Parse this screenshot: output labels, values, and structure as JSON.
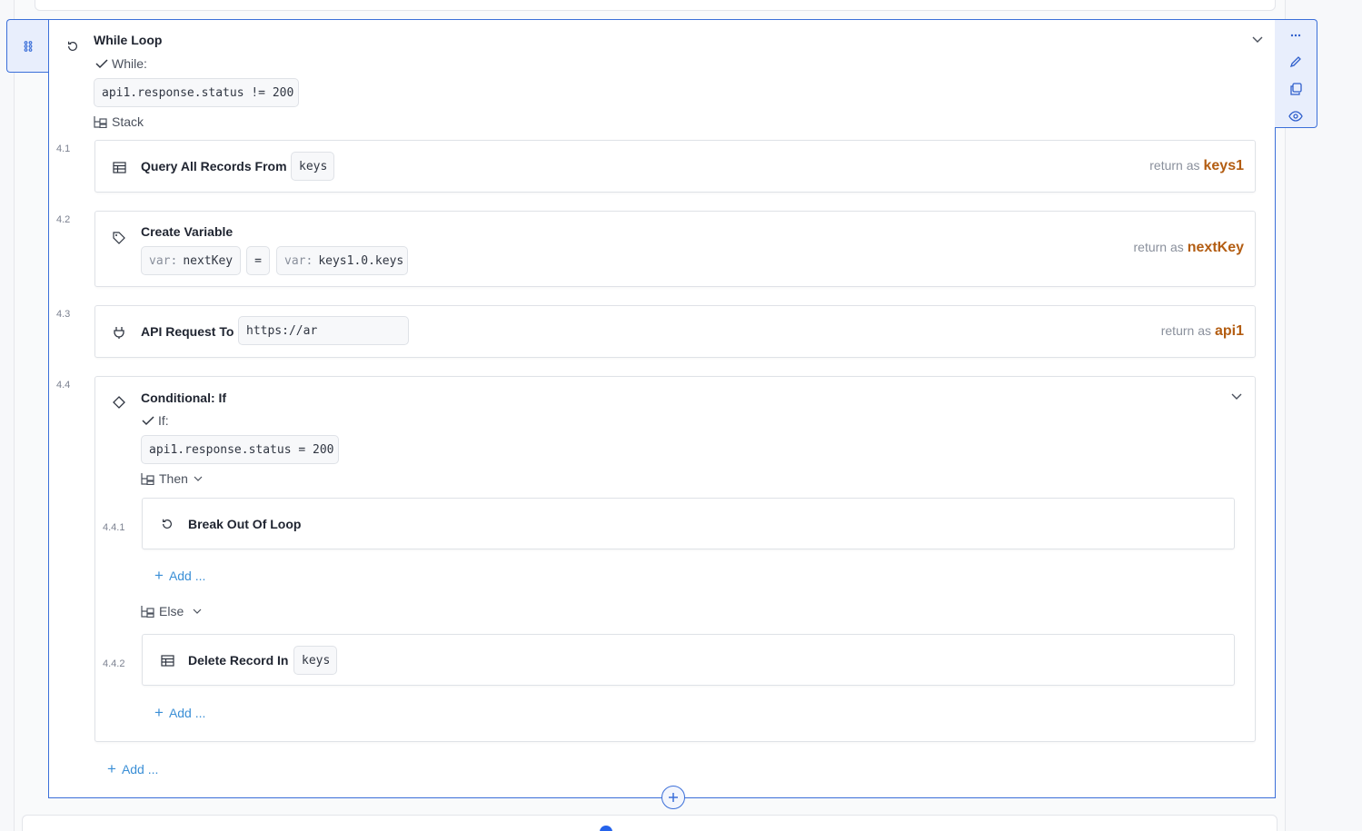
{
  "while_loop": {
    "title": "While Loop",
    "condition_label": "While:",
    "condition": "api1.response.status != 200",
    "stack_label": "Stack",
    "add_label": "Add ...",
    "steps": {
      "s1": {
        "num": "4.1",
        "title": "Query All Records From",
        "table": "keys",
        "return_prefix": "return as",
        "return_var": "keys1"
      },
      "s2": {
        "num": "4.2",
        "title": "Create Variable",
        "var_prefix": "var:",
        "var_name": "nextKey",
        "equals": "=",
        "value_prefix": "var:",
        "value": "keys1.0.keys",
        "return_prefix": "return as",
        "return_var": "nextKey"
      },
      "s3": {
        "num": "4.3",
        "title": "API Request To",
        "url": "https://ar",
        "return_prefix": "return as",
        "return_var": "api1"
      },
      "s4": {
        "num": "4.4",
        "title": "Conditional: If",
        "condition_label": "If:",
        "condition": "api1.response.status = 200",
        "then_label": "Then",
        "else_label": "Else",
        "then_step": {
          "num": "4.4.1",
          "title": "Break Out Of Loop"
        },
        "else_step": {
          "num": "4.4.2",
          "title": "Delete Record In",
          "table": "keys"
        },
        "then_add": "Add ...",
        "else_add": "Add ..."
      }
    }
  },
  "colors": {
    "accent": "#3b6fd9",
    "return_var": "#b35d12",
    "add_link": "#3b8fd6"
  },
  "icons": {
    "drag": "grid-dots-icon",
    "loop": "loop-icon",
    "collapse": "chevron-down-icon",
    "more": "more-icon",
    "edit": "pencil-icon",
    "duplicate": "copy-icon",
    "view": "eye-icon",
    "table": "table-icon",
    "variable": "tag-icon",
    "api": "plug-icon",
    "conditional": "diamond-icon"
  }
}
